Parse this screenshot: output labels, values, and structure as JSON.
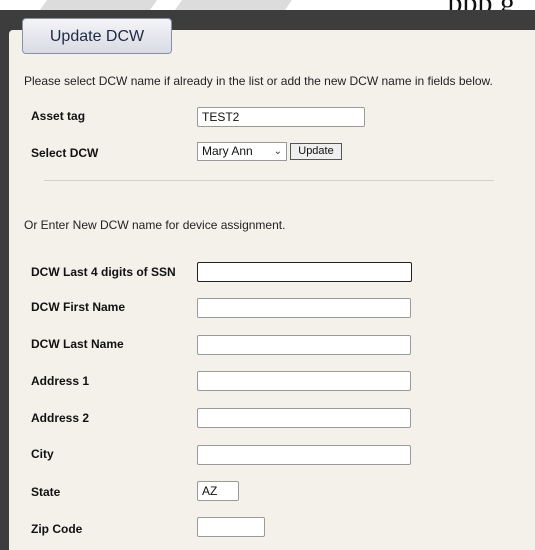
{
  "header": {
    "banner_text": "ppp g"
  },
  "tab": {
    "label": "Update DCW"
  },
  "instructions": {
    "select_text": "Please select DCW name if already in the list or add the new DCW name in fields below.",
    "new_text": "Or Enter New DCW name for device assignment."
  },
  "asset": {
    "label": "Asset tag",
    "value": "TEST2"
  },
  "select_dcw": {
    "label": "Select DCW",
    "selected": "Mary Ann",
    "button_label": "Update"
  },
  "fields": {
    "ssn": {
      "label": "DCW Last 4 digits of SSN",
      "value": ""
    },
    "first_name": {
      "label": "DCW First Name",
      "value": ""
    },
    "last_name": {
      "label": "DCW Last Name",
      "value": ""
    },
    "address1": {
      "label": "Address 1",
      "value": ""
    },
    "address2": {
      "label": "Address 2",
      "value": ""
    },
    "city": {
      "label": "City",
      "value": ""
    },
    "state": {
      "label": "State",
      "value": "AZ"
    },
    "zip": {
      "label": "Zip Code",
      "value": ""
    }
  }
}
